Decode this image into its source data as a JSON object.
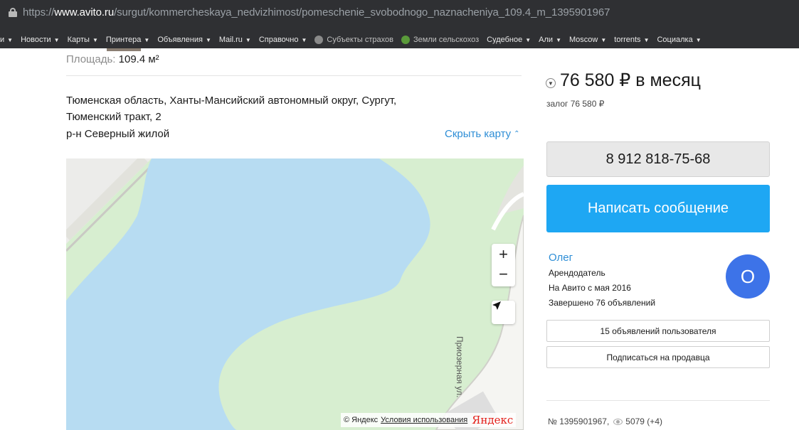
{
  "browser": {
    "url_prefix": "https://",
    "url_host": "www.avito.ru",
    "url_path": "/surgut/kommercheskaya_nedvizhimost/pomeschenie_svobodnogo_naznacheniya_109.4_m_1395901967"
  },
  "bookmarks": [
    {
      "label": "и",
      "caret": true
    },
    {
      "label": "Новости",
      "caret": true
    },
    {
      "label": "Карты",
      "caret": true
    },
    {
      "label": "Принтера",
      "caret": true
    },
    {
      "label": "Объявления",
      "caret": true
    },
    {
      "label": "Mail.ru",
      "caret": true
    },
    {
      "label": "Справочно",
      "caret": true
    },
    {
      "label": "Субъекты страхов",
      "caret": false,
      "icon": "emblem-icon"
    },
    {
      "label": "Земли сельскохоз",
      "caret": false,
      "icon": "shield-icon"
    },
    {
      "label": "Судебное",
      "caret": true
    },
    {
      "label": "Али",
      "caret": true
    },
    {
      "label": "Moscow",
      "caret": true
    },
    {
      "label": "torrents",
      "caret": true
    },
    {
      "label": "Социалка",
      "caret": true
    }
  ],
  "listing": {
    "area_label": "Площадь:",
    "area_value": "109.4 м²",
    "address_line1": "Тюменская область, Ханты-Мансийский автономный округ, Сургут,",
    "address_line2": "Тюменский тракт, 2",
    "district": "р-н Северный жилой",
    "hide_map": "Скрыть карту"
  },
  "map": {
    "zoom_in": "+",
    "zoom_out": "−",
    "street": "Приозерная ул.",
    "copyright": "© Яндекс",
    "terms": "Условия использования",
    "logo": "Яндекс"
  },
  "sidebar": {
    "price": "76 580 ₽ в месяц",
    "deposit": "залог 76 580 ₽",
    "phone": "8 912 818-75-68",
    "message_button": "Написать сообщение",
    "seller_name": "Олег",
    "seller_role": "Арендодатель",
    "seller_since": "На Авито с мая 2016",
    "seller_completed": "Завершено 76 объявлений",
    "avatar_letter": "О",
    "user_listings_button": "15 объявлений пользователя",
    "subscribe_button": "Подписаться на продавца",
    "listing_number": "№ 1395901967,",
    "views": "5079 (+4)"
  },
  "colors": {
    "water": "#b7dcf2",
    "park": "#d7eed0",
    "link": "#2e8ed6",
    "primary_button": "#1ea7f3",
    "avatar": "#3d73e8",
    "browser_chrome": "#2f3033"
  }
}
